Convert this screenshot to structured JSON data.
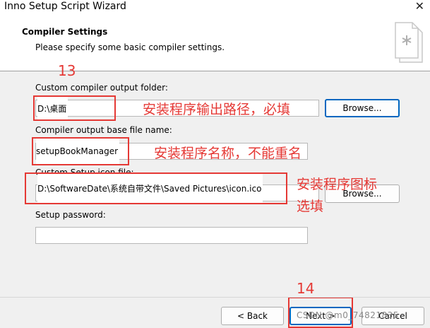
{
  "window": {
    "title": "Inno Setup Script Wizard",
    "close_glyph": "✕"
  },
  "header": {
    "title": "Compiler Settings",
    "subtitle": "Please specify some basic compiler settings.",
    "icon": "wizard-document-icon"
  },
  "fields": {
    "output_folder": {
      "label": "Custom compiler output folder:",
      "value": "D:\\桌面",
      "browse_label": "Browse..."
    },
    "base_file_name": {
      "label": "Compiler output base file name:",
      "value": "setupBookManager"
    },
    "icon_file": {
      "label": "Custom Setup icon file:",
      "value": "D:\\SoftwareDate\\系统自带文件\\Saved Pictures\\icon.ico",
      "browse_label": "Browse..."
    },
    "password": {
      "label": "Setup password:",
      "value": ""
    }
  },
  "annotations": {
    "step_13": "13",
    "step_14": "14",
    "output_folder_note": "安装程序输出路径，必填",
    "base_name_note": "安装程序名称，不能重名",
    "icon_note_line1": "安装程序图标",
    "icon_note_line2": "选填"
  },
  "footer": {
    "back_label": "< Back",
    "next_label": "Next >",
    "cancel_label": "Cancel",
    "watermark": "CSDN @m0_74821835"
  },
  "colors": {
    "annotation": "#e53935",
    "focus": "#0067c0",
    "background": "#f0f0f0"
  }
}
